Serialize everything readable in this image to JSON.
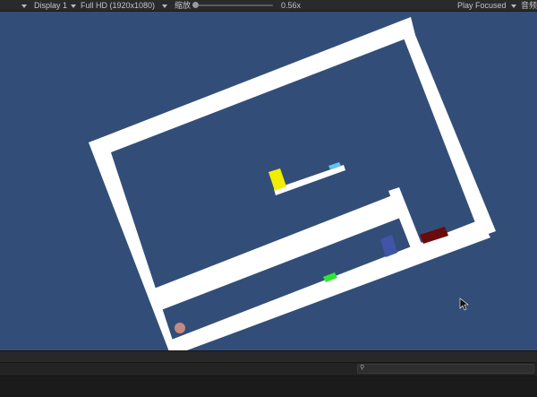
{
  "toolbar": {
    "display": "Display 1",
    "resolution": "Full HD (1920x1080)",
    "scale_label": "缩放",
    "scale_value": "0.56x",
    "scale_fraction": 0.05,
    "play_mode": "Play Focused",
    "right_label": "音频"
  },
  "icons": {
    "search": "search-icon",
    "cursor": "mouse-pointer-icon",
    "dropdown": "chevron-down-icon"
  },
  "colors": {
    "viewport_bg": "#324e78",
    "walls": "#ffffff",
    "yellow_block": "#f2ee00",
    "blue_platform_marker": "#5ec8f0",
    "dark_red_block": "#6b0a0a",
    "blue_block": "#4055a8",
    "green_block": "#2fe637",
    "ball": "#c48a80"
  }
}
